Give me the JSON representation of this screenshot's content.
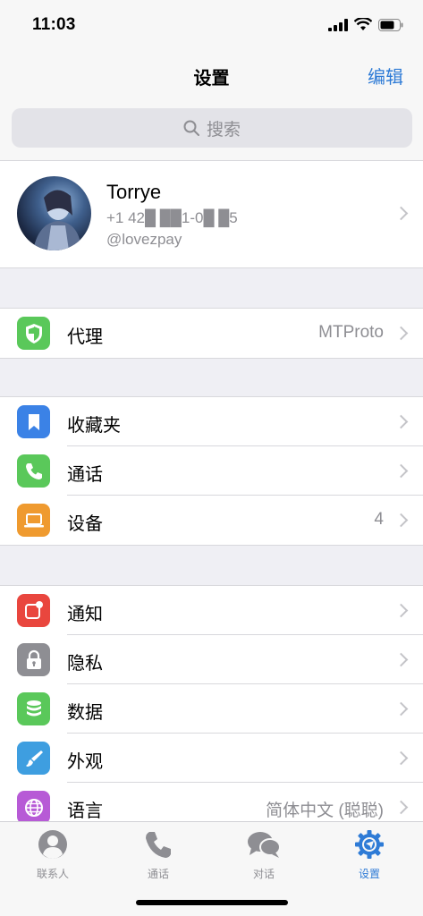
{
  "status": {
    "time": "11:03"
  },
  "nav": {
    "title": "设置",
    "edit": "编辑"
  },
  "search": {
    "placeholder": "搜索"
  },
  "profile": {
    "name": "Torrye",
    "phone": "+1 42█ ██1-0█ █5",
    "username": "@lovezpay"
  },
  "section1": [
    {
      "label": "代理",
      "value": "MTProto",
      "icon": "shield-icon",
      "color": "#5ac85a"
    }
  ],
  "section2": [
    {
      "label": "收藏夹",
      "value": "",
      "icon": "bookmark-icon",
      "color": "#3b82e6"
    },
    {
      "label": "通话",
      "value": "",
      "icon": "phone-icon",
      "color": "#5ac85a"
    },
    {
      "label": "设备",
      "value": "4",
      "icon": "laptop-icon",
      "color": "#ef9a2f"
    }
  ],
  "section3": [
    {
      "label": "通知",
      "value": "",
      "icon": "notification-icon",
      "color": "#e9463e"
    },
    {
      "label": "隐私",
      "value": "",
      "icon": "lock-icon",
      "color": "#8e8e93"
    },
    {
      "label": "数据",
      "value": "",
      "icon": "database-icon",
      "color": "#5ac85a"
    },
    {
      "label": "外观",
      "value": "",
      "icon": "brush-icon",
      "color": "#3e9ee0"
    },
    {
      "label": "语言",
      "value": "简体中文 (聪聪)",
      "icon": "globe-icon",
      "color": "#b75ad6"
    }
  ],
  "tabs": [
    {
      "label": "联系人",
      "icon": "contacts-icon"
    },
    {
      "label": "通话",
      "icon": "phone-icon"
    },
    {
      "label": "对话",
      "icon": "chats-icon"
    },
    {
      "label": "设置",
      "icon": "settings-icon",
      "active": true
    }
  ],
  "colors": {
    "accent": "#2e7bd6"
  }
}
